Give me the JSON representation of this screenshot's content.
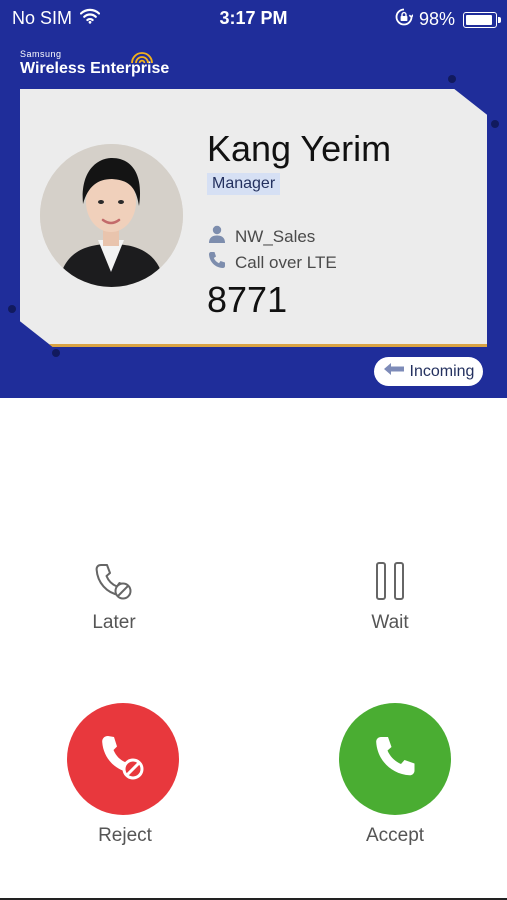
{
  "status_bar": {
    "carrier": "No SIM",
    "time": "3:17 PM",
    "battery_percent": "98%",
    "battery_level": 0.98
  },
  "brand": {
    "small": "Samsung",
    "big": "Wireless Enterprise"
  },
  "caller": {
    "name": "Kang Yerim",
    "role": "Manager",
    "department": "NW_Sales",
    "call_type": "Call over LTE",
    "extension": "8771"
  },
  "call_state": {
    "label": "Incoming"
  },
  "actions": {
    "later_label": "Later",
    "wait_label": "Wait",
    "reject_label": "Reject",
    "accept_label": "Accept"
  },
  "colors": {
    "header_blue": "#1f2d9a",
    "reject_red": "#e8383d",
    "accept_green": "#4aad32",
    "card_accent": "#d9a344"
  }
}
